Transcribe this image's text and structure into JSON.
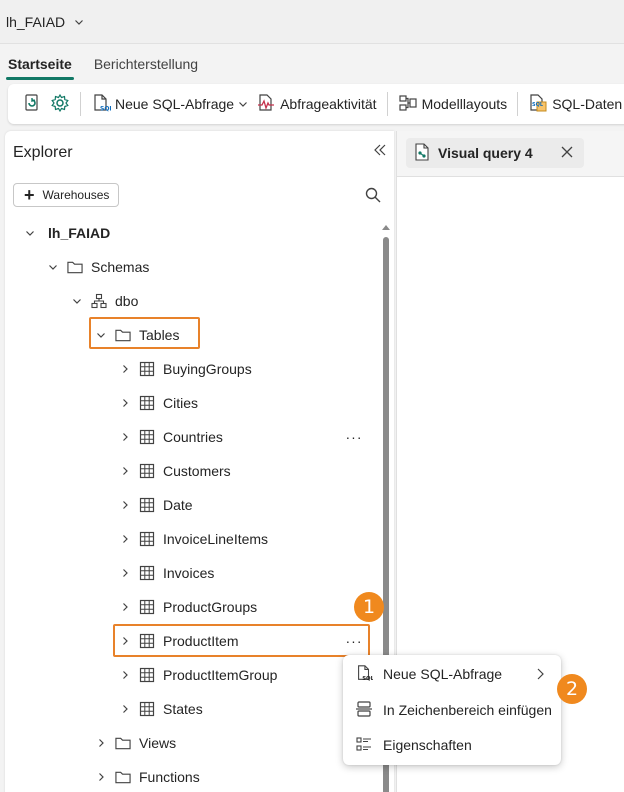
{
  "window": {
    "title": "lh_FAIAD"
  },
  "ribbon": {
    "tabs": [
      {
        "label": "Startseite",
        "active": true
      },
      {
        "label": "Berichterstellung",
        "active": false
      }
    ]
  },
  "toolbar": {
    "new_sql": "Neue SQL-Abfrage",
    "query_activity": "Abfrageaktivität",
    "model_layouts": "Modelllayouts",
    "sql_endpoint": "SQL-Daten"
  },
  "explorer": {
    "title": "Explorer",
    "add_button": "Warehouses",
    "tree": {
      "root": "lh_FAIAD",
      "schemas": "Schemas",
      "dbo": "dbo",
      "tables": "Tables",
      "table_items": [
        "BuyingGroups",
        "Cities",
        "Countries",
        "Customers",
        "Date",
        "InvoiceLineItems",
        "Invoices",
        "ProductGroups",
        "ProductItem",
        "ProductItemGroup",
        "States"
      ],
      "views": "Views",
      "functions": "Functions"
    },
    "more_glyph": "···"
  },
  "canvas": {
    "tab_label": "Visual query 4"
  },
  "context_menu": {
    "items": [
      {
        "label": "Neue SQL-Abfrage",
        "has_submenu": true
      },
      {
        "label": "In Zeichenbereich einfügen"
      },
      {
        "label": "Eigenschaften"
      }
    ]
  },
  "annotations": {
    "step1": "1",
    "step2": "2"
  },
  "colors": {
    "accent": "#117865",
    "highlight": "#e8822a",
    "badge": "#f0891e"
  }
}
